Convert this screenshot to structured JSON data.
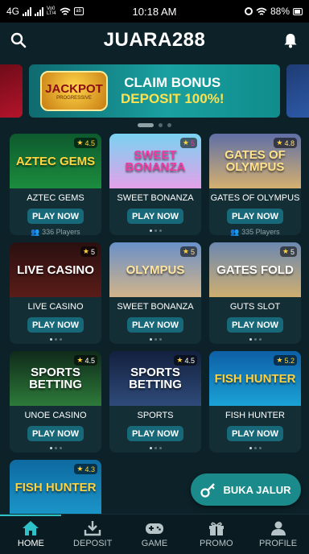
{
  "status": {
    "network": "4G",
    "network2": "LTE",
    "volte_top": "Vo0",
    "volte_bottom": "LT/4",
    "time": "10:18 AM",
    "battery": "88%"
  },
  "header": {
    "title": "JUARA288"
  },
  "banner": {
    "jackpot": "JACKPOT",
    "jackpot_sub": "PROGRESSIVE",
    "line1": "CLAIM BONUS",
    "line2": "DEPOSIT 100%!"
  },
  "games": [
    {
      "thumb_title": "AZTEC GEMS",
      "rating": "4.5",
      "name": "AZTEC GEMS",
      "button": "PLAY NOW",
      "players": "336 Players"
    },
    {
      "thumb_title": "SWEET BONANZA",
      "rating": "5",
      "name": "SWEET BONANZA",
      "button": "PLAY NOW",
      "players": ""
    },
    {
      "thumb_title": "GATES OF OLYMPUS",
      "rating": "4.8",
      "name": "GATES OF OLYMPUS",
      "button": "PLAY NOW",
      "players": "335 Players"
    },
    {
      "thumb_title": "LIVE CASINO",
      "rating": "5",
      "name": "LIVE CASINO",
      "button": "PLAY NOW",
      "players": ""
    },
    {
      "thumb_title": "OLYMPUS",
      "rating": "5",
      "name": "SWEET BONANZA",
      "button": "PLAY NOW",
      "players": ""
    },
    {
      "thumb_title": "GATES FOLD",
      "rating": "5",
      "name": "GUTS SLOT",
      "button": "PLAY NOW",
      "players": ""
    },
    {
      "thumb_title": "SPORTS BETTING",
      "rating": "4.5",
      "name": "UNOE CASINO",
      "button": "PLAY NOW",
      "players": ""
    },
    {
      "thumb_title": "SPORTS BETTING",
      "rating": "4.5",
      "name": "SPORTS",
      "button": "PLAY NOW",
      "players": ""
    },
    {
      "thumb_title": "FISH HUNTER",
      "rating": "5.2",
      "name": "FISH HUNTER",
      "button": "PLAY NOW",
      "players": ""
    },
    {
      "thumb_title": "FISH HUNTER",
      "rating": "4.3",
      "name": "",
      "button": "",
      "players": ""
    }
  ],
  "float_button": {
    "label": "BUKA JALUR"
  },
  "nav": [
    {
      "label": "HOME",
      "icon": "home-icon",
      "active": true
    },
    {
      "label": "DEPOSIT",
      "icon": "deposit-icon",
      "active": false
    },
    {
      "label": "GAME",
      "icon": "gamepad-icon",
      "active": false
    },
    {
      "label": "PROMO",
      "icon": "gift-icon",
      "active": false
    },
    {
      "label": "PROFILE",
      "icon": "profile-icon",
      "active": false
    }
  ],
  "colors": {
    "accent": "#2ec2c8",
    "button": "#17697a",
    "background": "#0c2228"
  }
}
